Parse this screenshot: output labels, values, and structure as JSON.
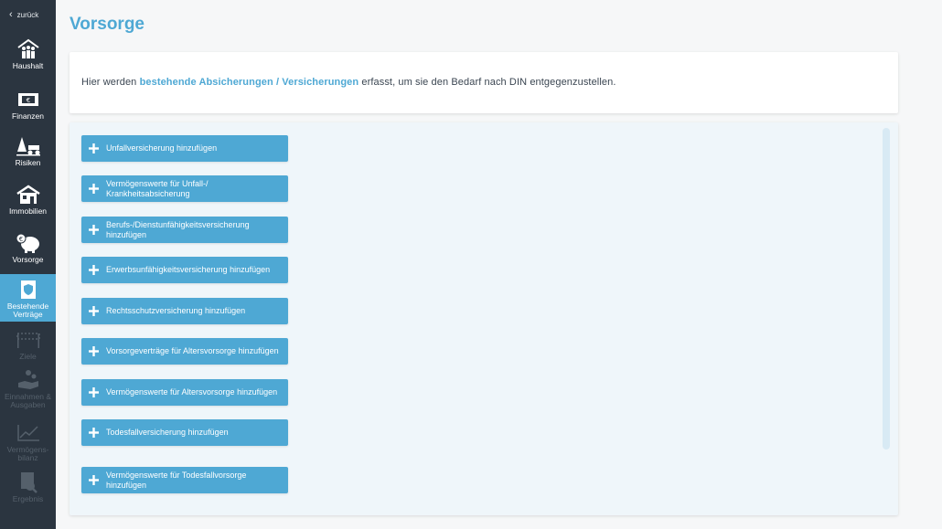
{
  "nav": {
    "back_label": "zurück",
    "items": [
      {
        "label": "Haushalt",
        "icon": "family-house-icon",
        "state": "enabled"
      },
      {
        "label": "Finanzen",
        "icon": "money-icon",
        "state": "enabled"
      },
      {
        "label": "Risiken",
        "icon": "risk-icon",
        "state": "enabled"
      },
      {
        "label": "Immobilien",
        "icon": "house-icon",
        "state": "enabled"
      },
      {
        "label": "Vorsorge",
        "icon": "piggy-bank-icon",
        "state": "enabled"
      },
      {
        "label": "Bestehende Verträge",
        "icon": "contract-shield-icon",
        "state": "active"
      },
      {
        "label": "Ziele",
        "icon": "finish-flag-icon",
        "state": "disabled"
      },
      {
        "label": "Einnahmen & Ausgaben",
        "icon": "income-hand-icon",
        "state": "disabled"
      },
      {
        "label": "Vermögens-bilanz",
        "icon": "line-chart-icon",
        "state": "disabled"
      },
      {
        "label": "Ergebnis",
        "icon": "report-icon",
        "state": "disabled"
      }
    ]
  },
  "page": {
    "title": "Vorsorge",
    "info": {
      "prefix": "Hier werden ",
      "highlight": "bestehende Absicherungen / Versicherungen",
      "suffix": " erfasst, um sie den Bedarf nach DIN entgegenzustellen."
    }
  },
  "buttons": [
    "Unfallversicherung hinzufügen",
    "Vermögenswerte für Unfall-/ Krankheitsabsicherung",
    "Berufs-/Dienstunfähigkeitsversicherung hinzufügen",
    "Erwerbsunfähigkeitsversicherung hinzufügen",
    "Rechtsschutzversicherung hinzufügen",
    "Vorsorgeverträge für Altersvorsorge hinzufügen",
    "Vermögenswerte für Altersvorsorge hinzufügen",
    "Todesfallversicherung hinzufügen",
    "Vermögenswerte für Todesfallvorsorge hinzufügen"
  ],
  "colors": {
    "accent": "#4ea8d4",
    "sidebar": "#2b3540",
    "disabled": "#55606b"
  }
}
